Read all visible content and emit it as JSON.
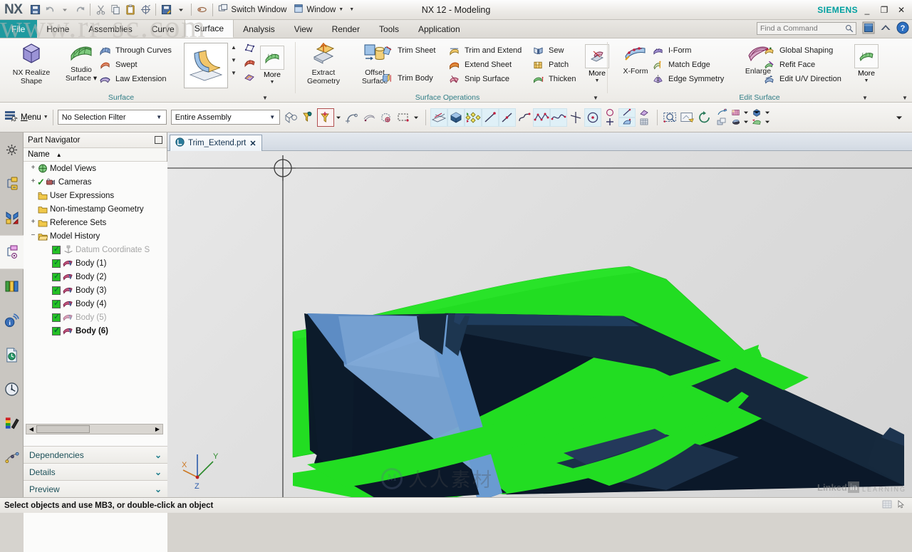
{
  "window": {
    "app_logo": "NX",
    "title": "NX 12 - Modeling",
    "brand": "SIEMENS",
    "minimize": "_",
    "restore": "❐",
    "close": "✕",
    "switch_window_label": "Switch Window",
    "window_label": "Window",
    "watermark_url": "www.rr-sc.com"
  },
  "quick_access": [
    {
      "name": "save-icon",
      "glyph": "floppy"
    },
    {
      "name": "undo-icon",
      "glyph": "undo"
    },
    {
      "name": "undo-dropdown-icon",
      "glyph": "caret"
    },
    {
      "name": "redo-icon",
      "glyph": "redo"
    },
    {
      "name": "cut-icon",
      "glyph": "scissors"
    },
    {
      "name": "copy-icon",
      "glyph": "copy"
    },
    {
      "name": "paste-icon",
      "glyph": "clipboard"
    },
    {
      "name": "transform-icon",
      "glyph": "transform"
    },
    {
      "name": "save-as-icon",
      "glyph": "save-as"
    },
    {
      "name": "save-as-dropdown-icon",
      "glyph": "caret"
    },
    {
      "name": "touch-mode-icon",
      "glyph": "finger"
    }
  ],
  "tabs": [
    {
      "label": "File",
      "kind": "file"
    },
    {
      "label": "Home",
      "kind": "normal"
    },
    {
      "label": "Assemblies",
      "kind": "normal"
    },
    {
      "label": "Curve",
      "kind": "normal"
    },
    {
      "label": "Surface",
      "kind": "active"
    },
    {
      "label": "Analysis",
      "kind": "normal"
    },
    {
      "label": "View",
      "kind": "normal"
    },
    {
      "label": "Render",
      "kind": "normal"
    },
    {
      "label": "Tools",
      "kind": "normal"
    },
    {
      "label": "Application",
      "kind": "normal"
    }
  ],
  "search": {
    "placeholder": "Find a Command"
  },
  "ribbon": {
    "groups": [
      {
        "label": "Surface",
        "big": [
          {
            "label": "NX Realize\nShape",
            "line1": "NX Realize",
            "line2": "Shape",
            "icon": "realize-shape-icon"
          },
          {
            "label": "Studio\nSurface",
            "line1": "Studio",
            "line2": "Surface ▾",
            "icon": "studio-surface-icon"
          }
        ],
        "small": [
          {
            "label": "Through Curves",
            "icon": "through-curves-icon"
          },
          {
            "label": "Swept",
            "icon": "swept-icon"
          },
          {
            "label": "Law Extension",
            "icon": "law-extension-icon"
          }
        ],
        "gallery_icon": "surface-preview-icon",
        "more_label": "More",
        "stack_icons": [
          "four-point-surface-icon",
          "ruled-surface-icon",
          "bounded-plane-icon"
        ]
      },
      {
        "label": "Surface Operations",
        "big": [
          {
            "line1": "Extract",
            "line2": "Geometry",
            "icon": "extract-geometry-icon"
          },
          {
            "line1": "Offset",
            "line2": "Surface",
            "icon": "offset-surface-icon"
          }
        ],
        "small": [
          {
            "label": "Trim Sheet",
            "icon": "trim-sheet-icon"
          },
          {
            "label": "Trim Body",
            "icon": "trim-body-icon"
          },
          {
            "label": "Trim and Extend",
            "icon": "trim-and-extend-icon"
          },
          {
            "label": "Extend Sheet",
            "icon": "extend-sheet-icon"
          },
          {
            "label": "Snip Surface",
            "icon": "snip-surface-icon"
          },
          {
            "label": "Sew",
            "icon": "sew-icon"
          },
          {
            "label": "Patch",
            "icon": "patch-icon"
          },
          {
            "label": "Thicken",
            "icon": "thicken-icon"
          }
        ],
        "more_label": "More"
      },
      {
        "label": "Edit Surface",
        "big": [
          {
            "line1": "X-Form",
            "line2": "",
            "icon": "x-form-icon"
          },
          {
            "line1": "Enlarge",
            "line2": "",
            "icon": "enlarge-icon"
          }
        ],
        "small": [
          {
            "label": "I-Form",
            "icon": "i-form-icon"
          },
          {
            "label": "Match Edge",
            "icon": "match-edge-icon"
          },
          {
            "label": "Edge Symmetry",
            "icon": "edge-symmetry-icon"
          },
          {
            "label": "Global Shaping",
            "icon": "global-shaping-icon"
          },
          {
            "label": "Refit Face",
            "icon": "refit-face-icon"
          },
          {
            "label": "Edit U/V Direction",
            "icon": "edit-uv-direction-icon"
          }
        ],
        "more_label": "More"
      }
    ]
  },
  "selection_bar": {
    "menu_label": "Menu",
    "selection_filter": "No Selection Filter",
    "assembly_scope": "Entire Assembly",
    "tool_icons": [
      "select-objects-icon",
      "snap-filter-icon",
      "point-snap-filter-icon",
      "snap-dropdown-icon",
      "curve-rule-icon",
      "face-rule-icon",
      "body-scope-icon",
      "rectangle-select-icon",
      "select-dropdown-icon",
      "show-hide-icon",
      "show-shaded-icon",
      "move-object-icon",
      "line-icon",
      "line-point-icon",
      "arc-icon",
      "studio-spline-icon",
      "spline-icon",
      "datum-axis-icon",
      "circle-center-icon",
      "circle-icon",
      "sketch-curve-icon",
      "point-icon",
      "sketch-icon",
      "grid-icon",
      "zoom-window-icon",
      "fit-view-icon",
      "refresh-icon",
      "render-style-icon",
      "layout-icon",
      "layout-dropdown-icon",
      "orient-view-icon",
      "view-dropdown-icon",
      "visualize-icon",
      "visualize-dropdown-icon",
      "section-icon",
      "section-dropdown-icon",
      "overflow-icon"
    ]
  },
  "rail_icons": [
    {
      "name": "settings-icon",
      "active": false
    },
    {
      "name": "assembly-navigator-icon",
      "active": false
    },
    {
      "name": "constraint-navigator-icon",
      "active": false
    },
    {
      "name": "part-navigator-icon",
      "active": true
    },
    {
      "name": "reuse-library-icon",
      "active": false
    },
    {
      "name": "hd3d-tools-icon",
      "active": false
    },
    {
      "name": "web-browser-icon",
      "active": false
    },
    {
      "name": "history-icon",
      "active": false
    },
    {
      "name": "system-materials-icon",
      "active": false
    },
    {
      "name": "process-studio-icon",
      "active": false
    }
  ],
  "part_navigator": {
    "title": "Part Navigator",
    "column_header": "Name",
    "sort_glyph": "▲",
    "nodes": [
      {
        "label": "Model Views",
        "indent": 0,
        "expander": "+",
        "icon": "model-views-icon",
        "check": false,
        "state": "normal"
      },
      {
        "label": "Cameras",
        "indent": 0,
        "expander": "+",
        "icon": "cameras-icon",
        "check": false,
        "state": "normal",
        "tick": true
      },
      {
        "label": "User Expressions",
        "indent": 0,
        "expander": "",
        "icon": "expressions-icon",
        "check": false,
        "state": "normal"
      },
      {
        "label": "Non-timestamp Geometry",
        "indent": 0,
        "expander": "",
        "icon": "folder-icon",
        "check": false,
        "state": "normal"
      },
      {
        "label": "Reference Sets",
        "indent": 0,
        "expander": "+",
        "icon": "folder-icon",
        "check": false,
        "state": "normal"
      },
      {
        "label": "Model History",
        "indent": 0,
        "expander": "−",
        "icon": "folder-open-icon",
        "check": false,
        "state": "normal"
      },
      {
        "label": "Datum Coordinate S",
        "indent": 1,
        "expander": "",
        "icon": "datum-csys-icon",
        "check": true,
        "state": "dim"
      },
      {
        "label": "Body (1)",
        "indent": 1,
        "expander": "",
        "icon": "body-icon",
        "check": true,
        "state": "normal"
      },
      {
        "label": "Body (2)",
        "indent": 1,
        "expander": "",
        "icon": "body-icon",
        "check": true,
        "state": "normal"
      },
      {
        "label": "Body (3)",
        "indent": 1,
        "expander": "",
        "icon": "body-icon",
        "check": true,
        "state": "normal"
      },
      {
        "label": "Body (4)",
        "indent": 1,
        "expander": "",
        "icon": "body-icon",
        "check": true,
        "state": "normal"
      },
      {
        "label": "Body (5)",
        "indent": 1,
        "expander": "",
        "icon": "body-icon",
        "check": true,
        "state": "dim"
      },
      {
        "label": "Body (6)",
        "indent": 1,
        "expander": "",
        "icon": "body-icon",
        "check": true,
        "state": "bold"
      }
    ],
    "scroll_left": "◀",
    "scroll_right": "▶",
    "sections": [
      {
        "label": "Dependencies",
        "chevron": "⌄"
      },
      {
        "label": "Details",
        "chevron": "⌄"
      },
      {
        "label": "Preview",
        "chevron": "⌄"
      }
    ]
  },
  "document_tab": {
    "label": "Trim_Extend.prt",
    "close": "✕",
    "icon": "part-file-icon"
  },
  "viewport": {
    "triad": {
      "x_label": "X",
      "y_label": "Y",
      "z_label": "Z"
    },
    "watermark_text": "人人素材",
    "linkedin_mark": "Linked",
    "linkedin_in": "in",
    "learning_text": "LEARNING",
    "colors": {
      "green_surface": "#22dd22",
      "blue_sheet": "#6a9bd1",
      "dark_wall": "#16293d",
      "background": "#dedede"
    }
  },
  "status_bar": {
    "message": "Select objects and use MB3, or double-click an object"
  }
}
